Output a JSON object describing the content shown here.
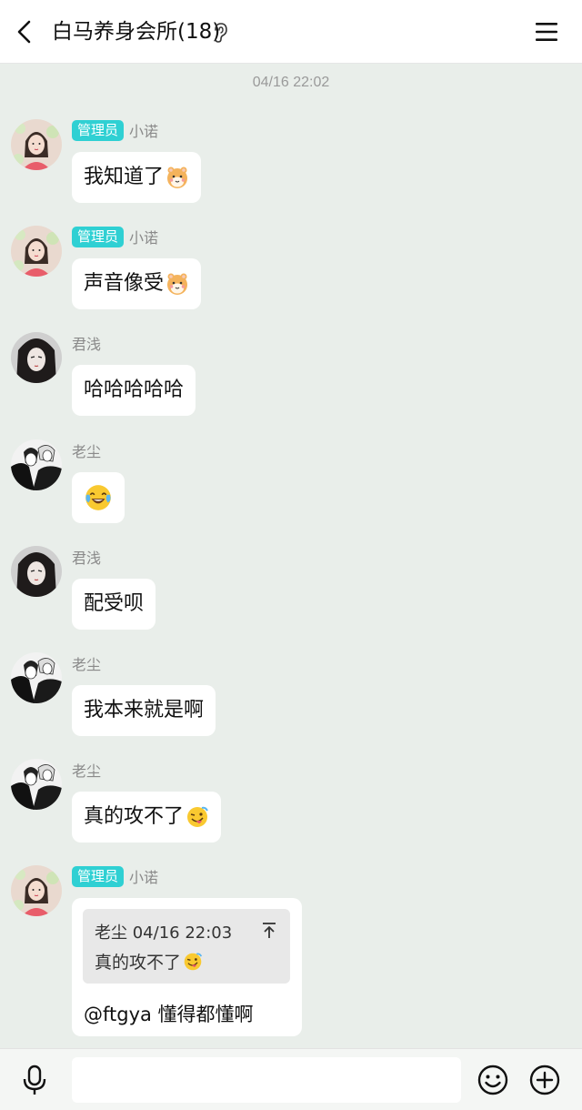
{
  "header": {
    "title": "白马养身会所(18)",
    "back_icon": "chevron-left-icon",
    "ear_icon": "ear-icon",
    "menu_icon": "menu-icon"
  },
  "timestamp": "04/16 22:02",
  "messages": [
    {
      "badge": "管理员",
      "name": "小诺",
      "text": "我知道了",
      "emoji": "hamster-emoji",
      "avatar": "avatar-xiaonuo"
    },
    {
      "badge": "管理员",
      "name": "小诺",
      "text": "声音像受",
      "emoji": "hamster-emoji",
      "avatar": "avatar-xiaonuo"
    },
    {
      "badge": "",
      "name": "君浅",
      "text": "哈哈哈哈哈",
      "emoji": "",
      "avatar": "avatar-junqian"
    },
    {
      "badge": "",
      "name": "老尘",
      "text": "",
      "emoji": "tears-of-joy-emoji",
      "avatar": "avatar-laochen"
    },
    {
      "badge": "",
      "name": "君浅",
      "text": "配受呗",
      "emoji": "",
      "avatar": "avatar-junqian"
    },
    {
      "badge": "",
      "name": "老尘",
      "text": "我本来就是啊",
      "emoji": "",
      "avatar": "avatar-laochen"
    },
    {
      "badge": "",
      "name": "老尘",
      "text": "真的攻不了",
      "emoji": "tongue-wink-emoji",
      "avatar": "avatar-laochen"
    },
    {
      "badge": "管理员",
      "name": "小诺",
      "avatar": "avatar-xiaonuo",
      "quote": {
        "header": "老尘 04/16 22:03",
        "text": "真的攻不了",
        "emoji": "tongue-wink-emoji",
        "icon": "jump-to-top-icon"
      },
      "text": "@ftgya 懂得都懂啊"
    }
  ],
  "bottom_bar": {
    "mic_icon": "microphone-icon",
    "input_placeholder": "",
    "emoji_icon": "smiley-icon",
    "plus_icon": "plus-circle-icon"
  },
  "colors": {
    "background": "#e9eeea",
    "badge": "#2fd0d3",
    "bubble": "#ffffff",
    "quote_bg": "#e8e8e8"
  }
}
